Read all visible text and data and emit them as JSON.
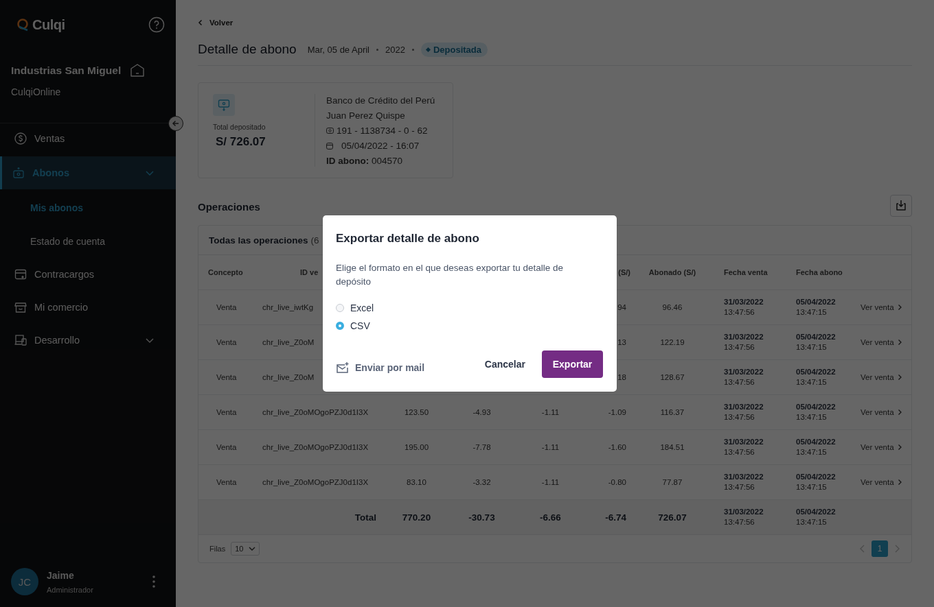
{
  "sidebar": {
    "logo": "Culqi",
    "business": "Industrias San Miguel",
    "store": "CulqiOnline",
    "items": [
      {
        "label": "Ventas",
        "selected": false,
        "has_submenu": false
      },
      {
        "label": "Abonos",
        "selected": true,
        "has_submenu": true,
        "children": [
          {
            "label": "Mis abonos",
            "selected": true
          },
          {
            "label": "Estado de cuenta",
            "selected": false
          }
        ]
      },
      {
        "label": "Contracargos",
        "selected": false,
        "has_submenu": false
      },
      {
        "label": "Mi comercio",
        "selected": false,
        "has_submenu": false
      },
      {
        "label": "Desarrollo",
        "selected": false,
        "has_submenu": true
      }
    ],
    "user": {
      "initials": "JC",
      "name": "Jaime",
      "role": "Administrador"
    }
  },
  "header": {
    "back": "Volver",
    "title": "Detalle de abono",
    "date": "Mar, 05 de April",
    "year": "2022",
    "status": "Depositada"
  },
  "summary": {
    "label": "Total depositado",
    "amount": "S/ 726.07",
    "bank": "Banco de Crédito del Perú",
    "holder": "Juan Perez Quispe",
    "account": "191 - 1138734 - 0 - 62",
    "datetime": "05/04/2022 - 16:07",
    "deposit_id": "**ID abono:** 004570"
  },
  "operations": {
    "title": "Operaciones",
    "table_title": "Todas las operaciones",
    "count": "(6",
    "columns": [
      "Concepto",
      "ID ve",
      null,
      null,
      null,
      "(S/)",
      "Abonado (S/)",
      "Fecha venta",
      "Fecha abono"
    ],
    "rows": [
      {
        "cells": [
          "Venta",
          "chr_live_iwtKg",
          null,
          null,
          null,
          "94",
          "96.46"
        ],
        "sale_date": {
          "date": "31/03/2022",
          "time": "13:47:56"
        },
        "deposit_date": {
          "date": "05/04/2022",
          "time": "13:47:15"
        },
        "action": "Ver venta"
      },
      {
        "cells": [
          "Venta",
          "chr_live_Z0oM",
          null,
          null,
          null,
          "13",
          "122.19"
        ],
        "sale_date": {
          "date": "31/03/2022",
          "time": "13:47:56"
        },
        "deposit_date": {
          "date": "05/04/2022",
          "time": "13:47:15"
        },
        "action": "Ver venta"
      },
      {
        "cells": [
          "Venta",
          "chr_live_Z0oM",
          null,
          null,
          null,
          "18",
          "128.67"
        ],
        "sale_date": {
          "date": "31/03/2022",
          "time": "13:47:56"
        },
        "deposit_date": {
          "date": "05/04/2022",
          "time": "13:47:15"
        },
        "action": "Ver venta"
      },
      {
        "cells": [
          "Venta",
          "chr_live_Z0oMOgoPZJ0d1I3X",
          "123.50",
          "-4.93",
          "-1.11",
          "-1.09",
          "116.37"
        ],
        "sale_date": {
          "date": "31/03/2022",
          "time": "13:47:56"
        },
        "deposit_date": {
          "date": "05/04/2022",
          "time": "13:47:15"
        },
        "action": "Ver venta"
      },
      {
        "cells": [
          "Venta",
          "chr_live_Z0oMOgoPZJ0d1I3X",
          "195.00",
          "-7.78",
          "-1.11",
          "-1.60",
          "184.51"
        ],
        "sale_date": {
          "date": "31/03/2022",
          "time": "13:47:56"
        },
        "deposit_date": {
          "date": "05/04/2022",
          "time": "13:47:15"
        },
        "action": "Ver venta"
      },
      {
        "cells": [
          "Venta",
          "chr_live_Z0oMOgoPZJ0d1I3X",
          "83.10",
          "-3.32",
          "-1.11",
          "-0.80",
          "77.87"
        ],
        "sale_date": {
          "date": "31/03/2022",
          "time": "13:47:56"
        },
        "deposit_date": {
          "date": "05/04/2022",
          "time": "13:47:15"
        },
        "action": "Ver venta"
      }
    ],
    "total": {
      "cells": [
        null,
        "Total",
        "770.20",
        "-30.73",
        "-6.66",
        "-6.74",
        "726.07"
      ],
      "sale_date": {
        "date": "31/03/2022",
        "time": "13:47:56"
      },
      "deposit_date": {
        "date": "05/04/2022",
        "time": "13:47:15"
      }
    },
    "rows_label": "Filas",
    "rows_per_page": "10",
    "pages": [
      {
        "label": "1",
        "selected": true
      }
    ]
  },
  "modal": {
    "title": "Exportar detalle de abono",
    "text": "Elige el formato en el que deseas exportar tu detalle de depósito",
    "options": [
      {
        "label": "Excel",
        "selected": false
      },
      {
        "label": "CSV",
        "selected": true
      }
    ],
    "mail": "Enviar por mail",
    "cancel": "Cancelar",
    "confirm": "Exportar"
  }
}
